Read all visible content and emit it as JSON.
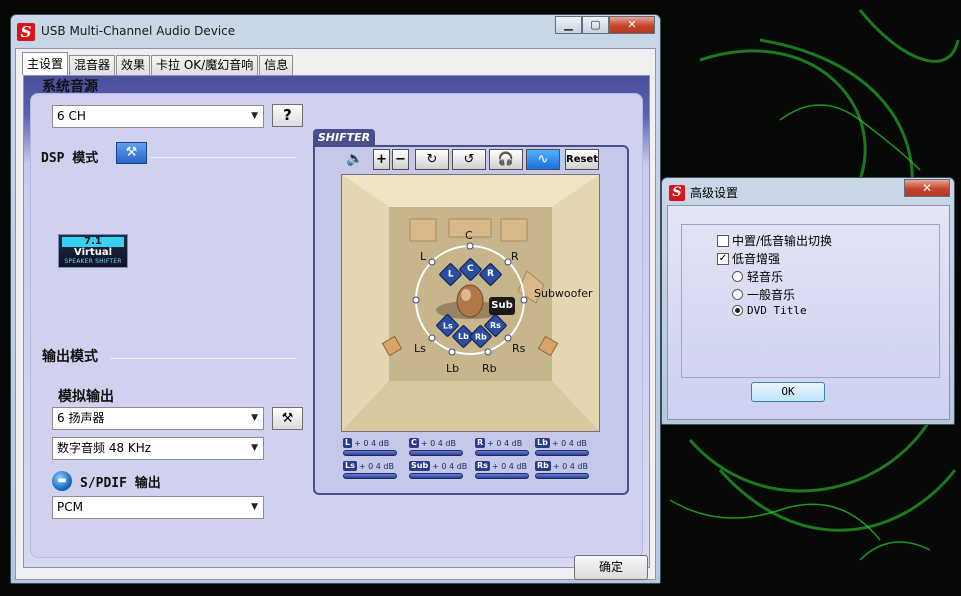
{
  "main_window": {
    "title": "USB Multi-Channel Audio Device",
    "tabs": [
      "主设置",
      "混音器",
      "效果",
      "卡拉 OK/魔幻音响",
      "信息"
    ],
    "active_tab": 0,
    "system_source": {
      "label": "系统音源",
      "value": "6 CH",
      "help_label": "?"
    },
    "dsp": {
      "label": "DSP 模式"
    },
    "virtual_logo": {
      "num": "7.1",
      "name": "Virtual",
      "sub": "SPEAKER SHIFTER"
    },
    "output": {
      "label": "输出模式",
      "analog_label": "模拟输出",
      "speaker_value": "6 扬声器",
      "digital_value": "数字音频 48 KHz",
      "spdif_label": "S/PDIF 输出",
      "spdif_value": "PCM"
    },
    "shifter": {
      "tab_label": "SHIFTER",
      "reset_label": "Reset",
      "labels": {
        "c": "C",
        "l": "L",
        "r": "R",
        "subwoofer": "Subwoofer",
        "ls": "Ls",
        "rs": "Rs",
        "lb": "Lb",
        "rb": "Rb"
      },
      "nodes": {
        "l": "L",
        "c": "C",
        "r": "R",
        "ls": "Ls",
        "rs": "Rs",
        "lb": "Lb",
        "rb": "Rb",
        "sub": "Sub"
      },
      "channels": [
        {
          "tag": "L",
          "value": "+ 0 4 dB"
        },
        {
          "tag": "C",
          "value": "+ 0 4 dB"
        },
        {
          "tag": "R",
          "value": "+ 0 4 dB"
        },
        {
          "tag": "Lb",
          "value": "+ 0 4 dB"
        },
        {
          "tag": "Ls",
          "value": "+ 0 4 dB"
        },
        {
          "tag": "Sub",
          "value": "+ 0 4 dB"
        },
        {
          "tag": "Rs",
          "value": "+ 0 4 dB"
        },
        {
          "tag": "Rb",
          "value": "+ 0 4 dB"
        }
      ]
    },
    "confirm_label": "确定"
  },
  "advanced_dialog": {
    "title": "高级设置",
    "options": [
      {
        "type": "checkbox",
        "label": "中置/低音输出切换",
        "checked": false
      },
      {
        "type": "checkbox",
        "label": "低音增强",
        "checked": true
      },
      {
        "type": "radio",
        "label": "轻音乐",
        "selected": false
      },
      {
        "type": "radio",
        "label": "一般音乐",
        "selected": false
      },
      {
        "type": "radio",
        "label": "DVD Title",
        "selected": true
      }
    ],
    "ok_label": "OK"
  },
  "colors": {
    "accent_blue": "#2a4fa0",
    "brand_red": "#d6151b",
    "razer_green": "#38ff3c"
  }
}
